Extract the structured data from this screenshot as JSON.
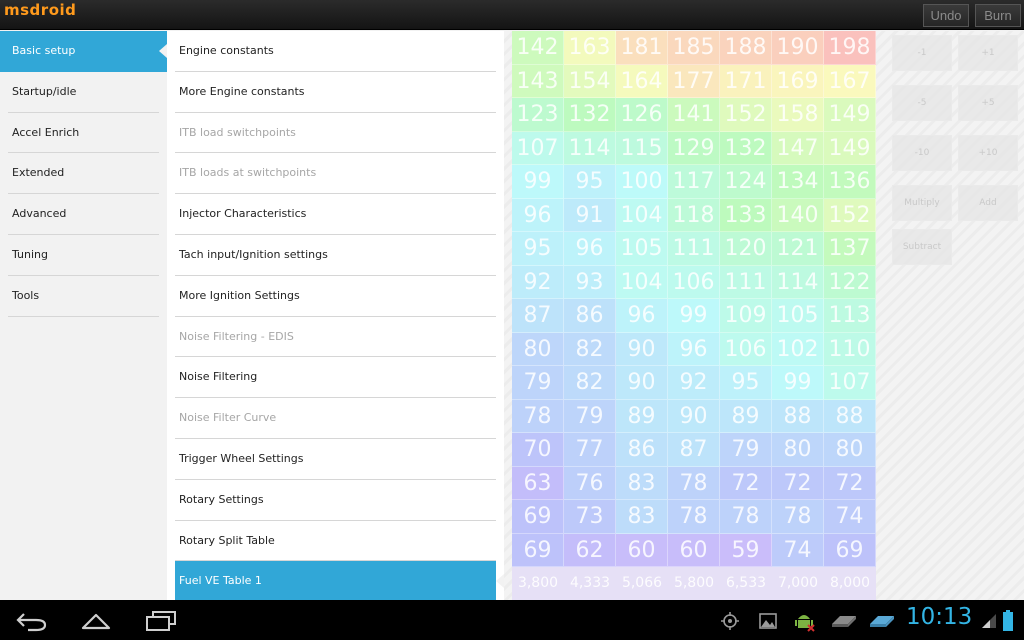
{
  "app": {
    "title": "msdroid"
  },
  "toolbar": {
    "undo_label": "Undo",
    "burn_label": "Burn"
  },
  "left_menu": {
    "items": [
      {
        "label": "Basic setup",
        "selected": true
      },
      {
        "label": "Startup/idle"
      },
      {
        "label": "Accel Enrich"
      },
      {
        "label": "Extended"
      },
      {
        "label": "Advanced"
      },
      {
        "label": "Tuning"
      },
      {
        "label": "Tools"
      }
    ]
  },
  "sub_menu": {
    "items": [
      {
        "label": "Engine constants"
      },
      {
        "label": "More Engine constants"
      },
      {
        "label": "ITB load switchpoints",
        "disabled": true
      },
      {
        "label": "ITB loads at switchpoints",
        "disabled": true
      },
      {
        "label": "Injector Characteristics"
      },
      {
        "label": "Tach input/Ignition settings"
      },
      {
        "label": "More Ignition Settings"
      },
      {
        "label": "Noise Filtering - EDIS",
        "disabled": true
      },
      {
        "label": "Noise Filtering"
      },
      {
        "label": "Noise Filter Curve",
        "disabled": true
      },
      {
        "label": "Trigger Wheel Settings"
      },
      {
        "label": "Rotary Settings"
      },
      {
        "label": "Rotary Split Table"
      },
      {
        "label": "Fuel VE Table 1",
        "selected": true
      }
    ]
  },
  "ve_table": {
    "rows": [
      [
        142,
        163,
        181,
        185,
        188,
        190,
        198
      ],
      [
        143,
        154,
        164,
        177,
        171,
        169,
        167
      ],
      [
        123,
        132,
        126,
        141,
        152,
        158,
        149
      ],
      [
        107,
        114,
        115,
        129,
        132,
        147,
        149
      ],
      [
        99,
        95,
        100,
        117,
        124,
        134,
        136
      ],
      [
        96,
        91,
        104,
        118,
        133,
        140,
        152
      ],
      [
        95,
        96,
        105,
        111,
        120,
        121,
        137
      ],
      [
        92,
        93,
        104,
        106,
        111,
        114,
        122
      ],
      [
        87,
        86,
        96,
        99,
        109,
        105,
        113
      ],
      [
        80,
        82,
        90,
        96,
        106,
        102,
        110
      ],
      [
        79,
        82,
        90,
        92,
        95,
        99,
        107
      ],
      [
        78,
        79,
        89,
        90,
        89,
        88,
        88
      ],
      [
        70,
        77,
        86,
        87,
        79,
        80,
        80
      ],
      [
        63,
        76,
        83,
        78,
        72,
        72,
        72
      ],
      [
        69,
        73,
        83,
        78,
        78,
        78,
        74
      ],
      [
        69,
        62,
        60,
        60,
        59,
        74,
        69
      ]
    ],
    "x_axis": [
      "3,800",
      "4,333",
      "5,066",
      "5,800",
      "6,533",
      "7,000",
      "8,000"
    ]
  },
  "controls": {
    "buttons": [
      {
        "label": "-1"
      },
      {
        "label": "+1"
      },
      {
        "label": "-5"
      },
      {
        "label": "+5"
      },
      {
        "label": "-10"
      },
      {
        "label": "+10"
      },
      {
        "label": "Multiply"
      },
      {
        "label": "Add"
      },
      {
        "label": "Subtract"
      }
    ]
  },
  "status": {
    "time": "10:13"
  },
  "colors": {
    "accent": "#31a7d7",
    "logo": "#ff9a1c",
    "clock": "#33b5e5"
  },
  "icons": {
    "nav": [
      "back-icon",
      "home-icon",
      "recent-apps-icon"
    ],
    "status": [
      "gps-icon",
      "gallery-icon",
      "android-debug-icon",
      "usb-storage-icon",
      "usb-drive-icon",
      "signal-icon",
      "battery-icon"
    ]
  }
}
